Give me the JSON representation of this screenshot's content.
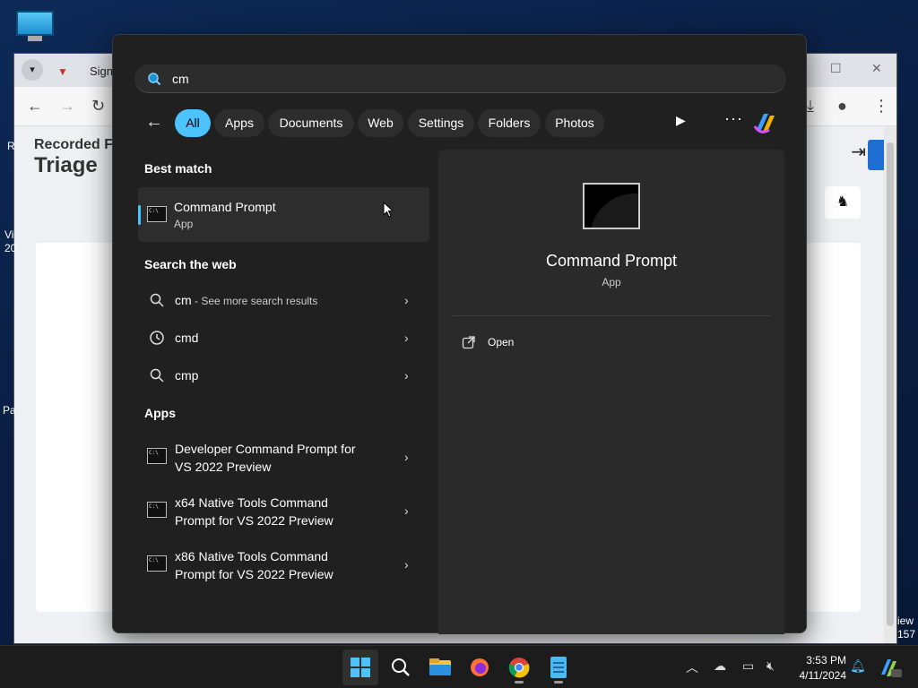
{
  "browser": {
    "tab_title": "Signup",
    "brand_line1": "Recorded Fu",
    "brand_line2": "Triage",
    "side_text_r": "R",
    "side_text_vi": "Vi",
    "side_text_20": "20",
    "side_text_pa": "Pa",
    "side_text_iew": "iew",
    "side_text_157": "157"
  },
  "start_menu": {
    "search": {
      "value": "cm"
    },
    "filters": [
      "All",
      "Apps",
      "Documents",
      "Web",
      "Settings",
      "Folders",
      "Photos"
    ],
    "active_filter": "All",
    "best_match_label": "Best match",
    "best_match": {
      "title": "Command Prompt",
      "subtitle": "App"
    },
    "search_web_label": "Search the web",
    "web_results": [
      {
        "text": "cm",
        "suffix": " - See more search results",
        "icon": "search-icon"
      },
      {
        "text": "cmd",
        "suffix": "",
        "icon": "history-icon"
      },
      {
        "text": "cmp",
        "suffix": "",
        "icon": "search-icon"
      }
    ],
    "apps_label": "Apps",
    "apps": [
      {
        "line1": "Developer Command Prompt for",
        "line2": "VS 2022 Preview"
      },
      {
        "line1": "x64 Native Tools Command",
        "line2": "Prompt for VS 2022 Preview"
      },
      {
        "line1": "x86 Native Tools Command",
        "line2": "Prompt for VS 2022 Preview"
      }
    ],
    "preview": {
      "title": "Command Prompt",
      "subtitle": "App",
      "action": "Open"
    }
  },
  "taskbar": {
    "apps": [
      "start-icon",
      "search-icon",
      "file-explorer-icon",
      "firefox-icon",
      "chrome-icon",
      "notepad-icon"
    ],
    "time": "3:53 PM",
    "date": "4/11/2024",
    "accent": "#4cc2ff"
  }
}
